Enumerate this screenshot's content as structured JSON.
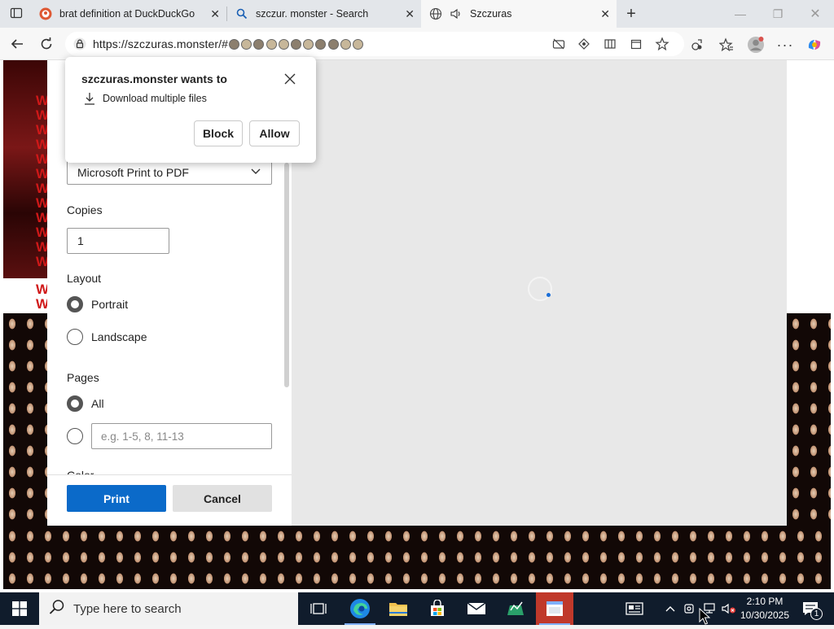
{
  "tabs": [
    {
      "title": "brat definition at DuckDuckGo",
      "icon": "duckduckgo-icon"
    },
    {
      "title": "szczur. monster - Search",
      "icon": "search-icon"
    },
    {
      "title": "Szczuras",
      "icon": "globe-icon",
      "audio": "speaker-icon",
      "active": true
    }
  ],
  "address": {
    "url": "https://szczuras.monster/#"
  },
  "page": {
    "w_text": "W"
  },
  "permission_popup": {
    "title": "szczuras.monster wants to",
    "request": "Download multiple files",
    "block_label": "Block",
    "allow_label": "Allow"
  },
  "print_dialog": {
    "printer": "Microsoft Print to PDF",
    "copies_label": "Copies",
    "copies_value": "1",
    "layout_label": "Layout",
    "portrait_label": "Portrait",
    "landscape_label": "Landscape",
    "pages_label": "Pages",
    "all_label": "All",
    "pages_placeholder": "e.g. 1-5, 8, 11-13",
    "partial_label": "Color",
    "print_label": "Print",
    "cancel_label": "Cancel",
    "layout_selected": "Portrait",
    "pages_selected": "All"
  },
  "taskbar": {
    "search_placeholder": "Type here to search",
    "time": "2:10 PM",
    "date": "10/30/2025",
    "notification_count": "1"
  },
  "colors": {
    "accent": "#0b6ac9",
    "taskbar": "#101c2c",
    "page_red": "#d01818"
  }
}
